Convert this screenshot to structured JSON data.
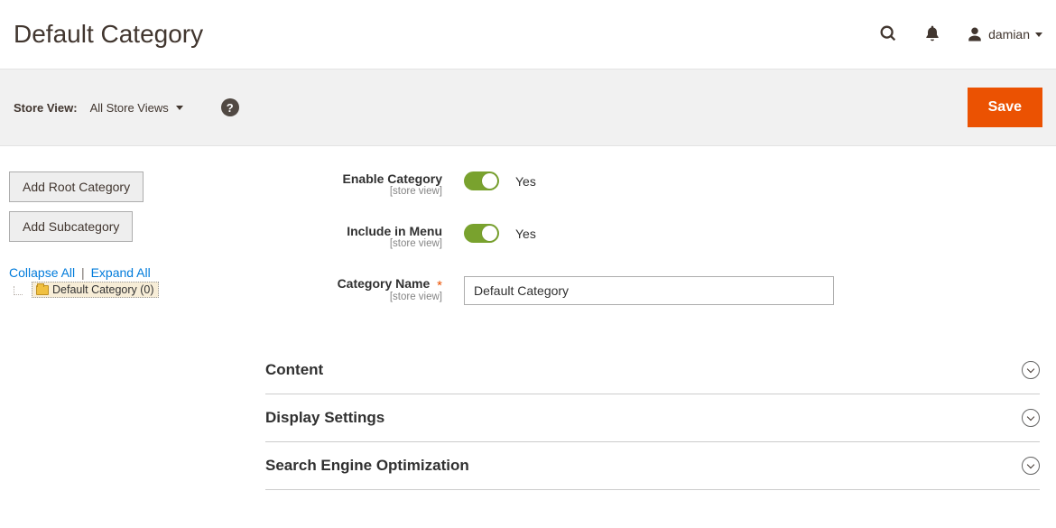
{
  "header": {
    "page_title": "Default Category",
    "user_name": "damian"
  },
  "action_bar": {
    "store_view_label": "Store View:",
    "store_view_value": "All Store Views",
    "save_label": "Save"
  },
  "sidebar": {
    "add_root_label": "Add Root Category",
    "add_sub_label": "Add Subcategory",
    "collapse_all_label": "Collapse All",
    "expand_all_label": "Expand All",
    "separator": "|",
    "tree_node_label": "Default Category (0)"
  },
  "form": {
    "enable_category": {
      "label": "Enable Category",
      "scope": "[store view]",
      "value_text": "Yes"
    },
    "include_in_menu": {
      "label": "Include in Menu",
      "scope": "[store view]",
      "value_text": "Yes"
    },
    "category_name": {
      "label": "Category Name",
      "scope": "[store view]",
      "value": "Default Category"
    }
  },
  "sections": [
    {
      "title": "Content"
    },
    {
      "title": "Display Settings"
    },
    {
      "title": "Search Engine Optimization"
    }
  ]
}
